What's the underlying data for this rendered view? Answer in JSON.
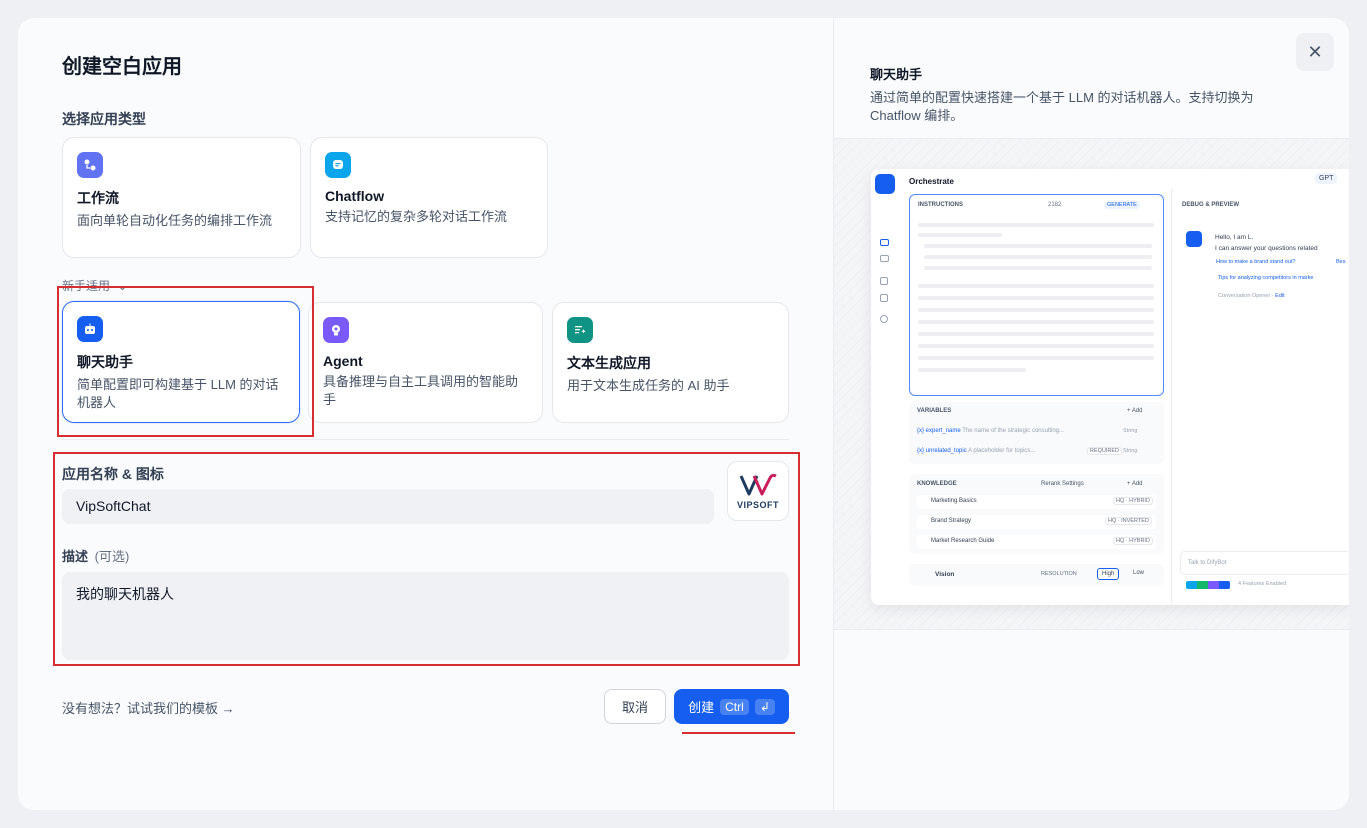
{
  "title": "创建空白应用",
  "app_type_label": "选择应用类型",
  "app_types": [
    {
      "icon": "workflow-icon",
      "name": "工作流",
      "desc": "面向单轮自动化任务的编排工作流",
      "color": "#6172f3"
    },
    {
      "icon": "chatflow-icon",
      "name": "Chatflow",
      "desc": "支持记忆的复杂多轮对话工作流",
      "color": "#0ba5ec"
    }
  ],
  "beginner_label": "新手适用",
  "beginner_types": [
    {
      "icon": "chatbot-icon",
      "name": "聊天助手",
      "desc": "简单配置即可构建基于 LLM 的对话机器人",
      "color": "#155eef"
    },
    {
      "icon": "agent-icon",
      "name": "Agent",
      "desc": "具备推理与自主工具调用的智能助手",
      "color": "#7a5af8"
    },
    {
      "icon": "text-gen-icon",
      "name": "文本生成应用",
      "desc": "用于文本生成任务的 AI 助手",
      "color": "#0e9384"
    }
  ],
  "name_label": "应用名称 & 图标",
  "name_value": "VipSoftChat",
  "logo_text": "VIPSOFT",
  "desc_label": "描述",
  "desc_optional": "(可选)",
  "desc_value": "我的聊天机器人",
  "template_link": "没有想法？试试我们的模板 →",
  "cancel_label": "取消",
  "create_label": "创建",
  "create_kbd": "Ctrl",
  "create_kbd2": "↲",
  "preview": {
    "title": "聊天助手",
    "desc": "通过简单的配置快速搭建一个基于 LLM 的对话机器人。支持切换为 Chatflow 编排。",
    "orchestrate": "Orchestrate",
    "model": "GPT",
    "instructions": "INSTRUCTIONS",
    "count": "2182",
    "generate": "GENERATE",
    "debug": "DEBUG & PREVIEW",
    "hello": "Hello, I am L.",
    "answer": "I can answer your questions related",
    "q1": "How to make a brand stand out?",
    "q2": "Bes",
    "q3": "Tips for analyzing competitors in marke",
    "opener": "Conversation Opener",
    "edit": "Edit",
    "variables": "VARIABLES",
    "add": "+ Add",
    "var1_name": "{x} expert_name",
    "var1_desc": "The name of the strategic consulting...",
    "var1_type": "String",
    "var2_name": "{x} unrelated_topic",
    "var2_desc": "A placeholder for topics...",
    "var2_req": "REQUIRED",
    "var2_type": "String",
    "knowledge": "KNOWLEDGE",
    "rerank": "Rerank Settings",
    "kb1": "Marketing Basics",
    "kb1_tag": "HQ · HYBRID",
    "kb2": "Brand Strategy",
    "kb2_tag": "HQ · INVERTED",
    "kb3": "Market Research Guide",
    "kb3_tag": "HQ · HYBRID",
    "vision": "Vision",
    "resolution": "RESOLUTION",
    "high": "High",
    "low": "Low",
    "talk": "Talk to DifyBot",
    "features": "4 Features Enabled"
  }
}
